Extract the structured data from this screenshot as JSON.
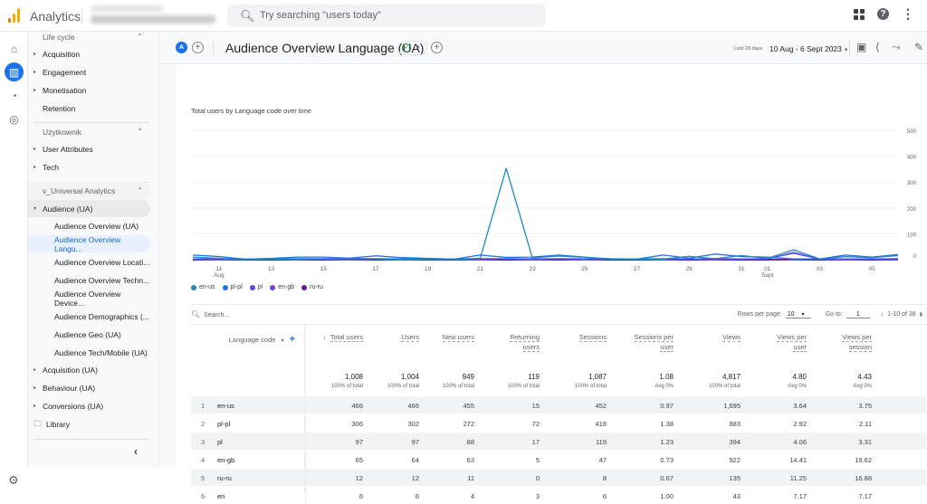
{
  "topbar": {
    "app_name": "Analytics",
    "search_placeholder": "Try searching \"users today\"",
    "logo_colors": [
      "#e37400",
      "#f9ab00",
      "#f9ab00"
    ]
  },
  "rail": {
    "items": [
      {
        "name": "home",
        "glyph": "⌂"
      },
      {
        "name": "reports",
        "glyph": "▥",
        "active": true
      },
      {
        "name": "explore",
        "glyph": "◔"
      },
      {
        "name": "advertising",
        "glyph": "◎"
      }
    ],
    "settings_glyph": "⚙"
  },
  "sidebar": {
    "lifecycle_header": "Life cycle",
    "lifecycle_items": [
      "Acquisition",
      "Engagement",
      "Monetisation",
      "Retention"
    ],
    "user_header": "Użytkownik",
    "user_items": [
      "User Attributes",
      "Tech"
    ],
    "ua_header": "v_Universal Analytics",
    "audience_label": "Audience (UA)",
    "audience_items": [
      "Audience Overview (UA)",
      "Audience Overview Langu...",
      "Audience Overview Locati...",
      "Audience Overview Techn...",
      "Audience Overview Device...",
      "Audience Demographics (...",
      "Audience Geo (UA)",
      "Audience Tech/Mobile (UA)"
    ],
    "selected_index": 1,
    "ua_items": [
      "Acquisition (UA)",
      "Behaviour (UA)",
      "Conversions (UA)"
    ],
    "library_label": "Library",
    "collapse_glyph": "‹"
  },
  "titlebar": {
    "avatar_letter": "A",
    "title": "Audience Overview Language (UA)",
    "date_prefix": "Last 28 days",
    "date_range": "10 Aug - 6 Sept 2023",
    "status": "published"
  },
  "chart_data": {
    "type": "line",
    "title": "Total users by Language code over time",
    "x": [
      "10 Aug",
      "11",
      "12",
      "13",
      "14",
      "15",
      "16",
      "17",
      "18",
      "19",
      "20",
      "21",
      "22",
      "23",
      "24",
      "25",
      "26",
      "27",
      "28",
      "29",
      "30",
      "31",
      "01 Sept",
      "02",
      "03",
      "04",
      "05",
      "06"
    ],
    "x_tick_labels": [
      "11\nAug",
      "13",
      "15",
      "17",
      "19",
      "21",
      "23",
      "25",
      "27",
      "29",
      "31",
      "01\nSept",
      "03",
      "05"
    ],
    "ylim": [
      0,
      500
    ],
    "y_ticks": [
      0,
      100,
      200,
      300,
      400,
      500
    ],
    "y_axis_side": "right",
    "grid": true,
    "legend_position": "bottom-left",
    "series": [
      {
        "name": "en-us",
        "color": "#1e88c7",
        "values": [
          10,
          5,
          1,
          2,
          3,
          4,
          5,
          3,
          2,
          1,
          1,
          5,
          353,
          7,
          14,
          9,
          4,
          2,
          2,
          13,
          4,
          16,
          5,
          38,
          3,
          12,
          8,
          16
        ]
      },
      {
        "name": "pl-pl",
        "color": "#1a73e8",
        "values": [
          18,
          12,
          2,
          5,
          10,
          10,
          6,
          15,
          8,
          5,
          2,
          18,
          9,
          10,
          18,
          10,
          2,
          2,
          18,
          6,
          22,
          12,
          10,
          3,
          3,
          18,
          10,
          20
        ]
      },
      {
        "name": "pl",
        "color": "#4f4fe8",
        "values": [
          3,
          3,
          2,
          3,
          4,
          3,
          4,
          4,
          3,
          3,
          3,
          4,
          4,
          3,
          4,
          3,
          3,
          3,
          4,
          3,
          4,
          3,
          4,
          25,
          3,
          3,
          3,
          4
        ]
      },
      {
        "name": "en-gb",
        "color": "#7b3fd6",
        "values": [
          2,
          2,
          2,
          2,
          3,
          2,
          3,
          3,
          2,
          2,
          2,
          3,
          3,
          2,
          3,
          2,
          2,
          2,
          3,
          2,
          3,
          2,
          3,
          28,
          2,
          2,
          2,
          3
        ]
      },
      {
        "name": "ru-ru",
        "color": "#6a1b9a",
        "values": [
          0,
          1,
          0,
          0,
          1,
          0,
          1,
          0,
          1,
          0,
          0,
          1,
          0,
          1,
          0,
          1,
          0,
          0,
          1,
          0,
          1,
          0,
          0,
          1,
          0,
          1,
          0,
          1
        ]
      }
    ]
  },
  "table": {
    "search_placeholder": "Search...",
    "rows_per_page_label": "Rows per page:",
    "rows_per_page": "10",
    "goto_label": "Go to:",
    "goto_value": "1",
    "range_label": "1-10 of 38",
    "dimension_header": "Language code",
    "columns": [
      {
        "label": "Total users",
        "sorted": true,
        "total": "1,008",
        "sub": "100% of total"
      },
      {
        "label": "Users",
        "total": "1,004",
        "sub": "100% of total"
      },
      {
        "label": "New users",
        "total": "949",
        "sub": "100% of total"
      },
      {
        "label": "Returning users",
        "l1": "Returning",
        "l2": "users",
        "total": "119",
        "sub": "100% of total"
      },
      {
        "label": "Sessions",
        "total": "1,087",
        "sub": "100% of total"
      },
      {
        "label": "Sessions per user",
        "l1": "Sessions per",
        "l2": "user",
        "total": "1.08",
        "sub": "Avg 0%"
      },
      {
        "label": "Views",
        "total": "4,817",
        "sub": "100% of total"
      },
      {
        "label": "Views per user",
        "l1": "Views per",
        "l2": "user",
        "total": "4.80",
        "sub": "Avg 0%"
      },
      {
        "label": "Views per session",
        "l1": "Views per",
        "l2": "session",
        "total": "4.43",
        "sub": "Avg 0%"
      }
    ],
    "rows": [
      {
        "n": "1",
        "dim": "en-us",
        "vals": [
          "466",
          "466",
          "455",
          "15",
          "452",
          "0.97",
          "1,695",
          "3.64",
          "3.75"
        ]
      },
      {
        "n": "2",
        "dim": "pl-pl",
        "vals": [
          "306",
          "302",
          "272",
          "72",
          "418",
          "1.38",
          "883",
          "2.92",
          "2.11"
        ]
      },
      {
        "n": "3",
        "dim": "pl",
        "vals": [
          "97",
          "97",
          "88",
          "17",
          "119",
          "1.23",
          "394",
          "4.06",
          "3.31"
        ]
      },
      {
        "n": "4",
        "dim": "en-gb",
        "vals": [
          "65",
          "64",
          "63",
          "5",
          "47",
          "0.73",
          "922",
          "14.41",
          "19.62"
        ]
      },
      {
        "n": "5",
        "dim": "ru-ru",
        "vals": [
          "12",
          "12",
          "11",
          "0",
          "8",
          "0.67",
          "135",
          "11.25",
          "16.88"
        ]
      },
      {
        "n": "6",
        "dim": "en",
        "vals": [
          "6",
          "6",
          "4",
          "3",
          "6",
          "1.00",
          "43",
          "7.17",
          "7.17"
        ]
      }
    ]
  }
}
